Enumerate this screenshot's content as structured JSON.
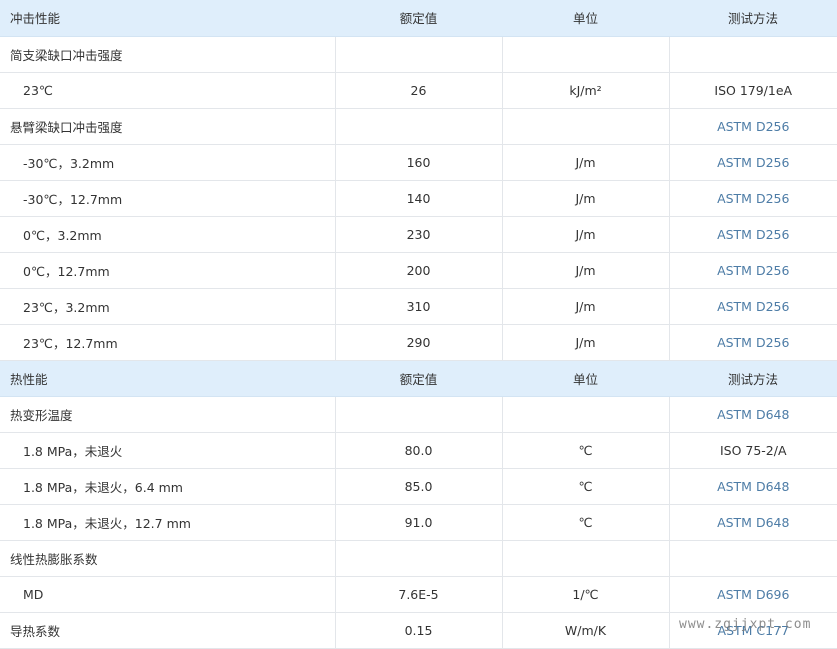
{
  "sections": [
    {
      "header": {
        "label": "冲击性能",
        "value": "额定值",
        "unit": "单位",
        "method": "测试方法"
      },
      "rows": [
        {
          "label": "简支梁缺口冲击强度",
          "value": "",
          "unit": "",
          "method": "",
          "indent": false
        },
        {
          "label": "23℃",
          "value": "26",
          "unit": "kJ/m²",
          "method": "ISO 179/1eA",
          "method_link": false,
          "indent": true
        },
        {
          "label": "悬臂梁缺口冲击强度",
          "value": "",
          "unit": "",
          "method": "ASTM D256",
          "method_link": true,
          "indent": false
        },
        {
          "label": "-30℃，3.2mm",
          "value": "160",
          "unit": "J/m",
          "method": "ASTM D256",
          "method_link": true,
          "indent": true
        },
        {
          "label": "-30℃，12.7mm",
          "value": "140",
          "unit": "J/m",
          "method": "ASTM D256",
          "method_link": true,
          "indent": true
        },
        {
          "label": "0℃，3.2mm",
          "value": "230",
          "unit": "J/m",
          "method": "ASTM D256",
          "method_link": true,
          "indent": true
        },
        {
          "label": "0℃，12.7mm",
          "value": "200",
          "unit": "J/m",
          "method": "ASTM D256",
          "method_link": true,
          "indent": true
        },
        {
          "label": "23℃，3.2mm",
          "value": "310",
          "unit": "J/m",
          "method": "ASTM D256",
          "method_link": true,
          "indent": true
        },
        {
          "label": "23℃，12.7mm",
          "value": "290",
          "unit": "J/m",
          "method": "ASTM D256",
          "method_link": true,
          "indent": true
        }
      ]
    },
    {
      "header": {
        "label": "热性能",
        "value": "额定值",
        "unit": "单位",
        "method": "测试方法"
      },
      "rows": [
        {
          "label": "热变形温度",
          "value": "",
          "unit": "",
          "method": "ASTM D648",
          "method_link": true,
          "indent": false
        },
        {
          "label": "1.8 MPa，未退火",
          "value": "80.0",
          "unit": "℃",
          "method": "ISO 75-2/A",
          "method_link": false,
          "indent": true
        },
        {
          "label": "1.8 MPa，未退火，6.4 mm",
          "value": "85.0",
          "unit": "℃",
          "method": "ASTM D648",
          "method_link": true,
          "indent": true
        },
        {
          "label": "1.8 MPa，未退火，12.7 mm",
          "value": "91.0",
          "unit": "℃",
          "method": "ASTM D648",
          "method_link": true,
          "indent": true
        },
        {
          "label": "线性热膨胀系数",
          "value": "",
          "unit": "",
          "method": "",
          "indent": false
        },
        {
          "label": "MD",
          "value": "7.6E-5",
          "unit": "1/℃",
          "method": "ASTM D696",
          "method_link": true,
          "indent": true
        },
        {
          "label": "导热系数",
          "value": "0.15",
          "unit": "W/m/K",
          "method": "ASTM C177",
          "method_link": true,
          "indent": false
        }
      ]
    }
  ],
  "watermark": "www.zgjjxpt.com",
  "colors": {
    "section_bg": "#dfeefb",
    "link": "#4d7ca6",
    "border": "#e3e6ea",
    "text": "#333333"
  }
}
